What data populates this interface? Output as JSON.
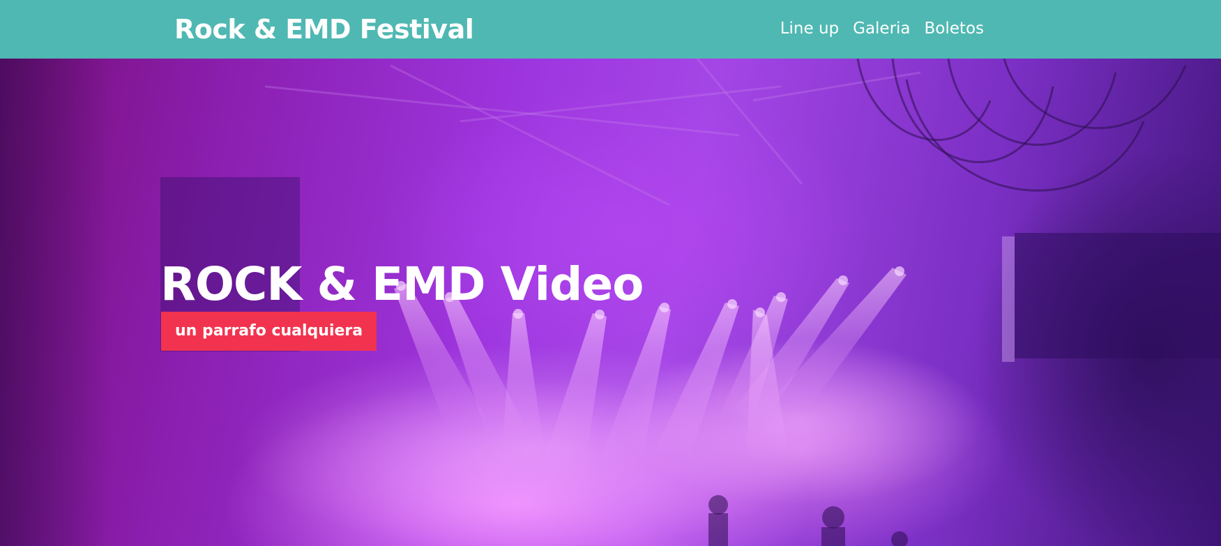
{
  "header": {
    "brand": "Rock & EMD Festival",
    "nav": [
      "Line up",
      "Galeria",
      "Boletos"
    ]
  },
  "hero": {
    "title": "ROCK & EMD Video",
    "tagline": "un parrafo cualquiera",
    "background": "concert stage with purple lights and haze"
  },
  "colors": {
    "header_bg": "#4fb8b2",
    "tag_bg": "#f2334f",
    "text": "#ffffff",
    "hero_purple": "#a446e6"
  }
}
